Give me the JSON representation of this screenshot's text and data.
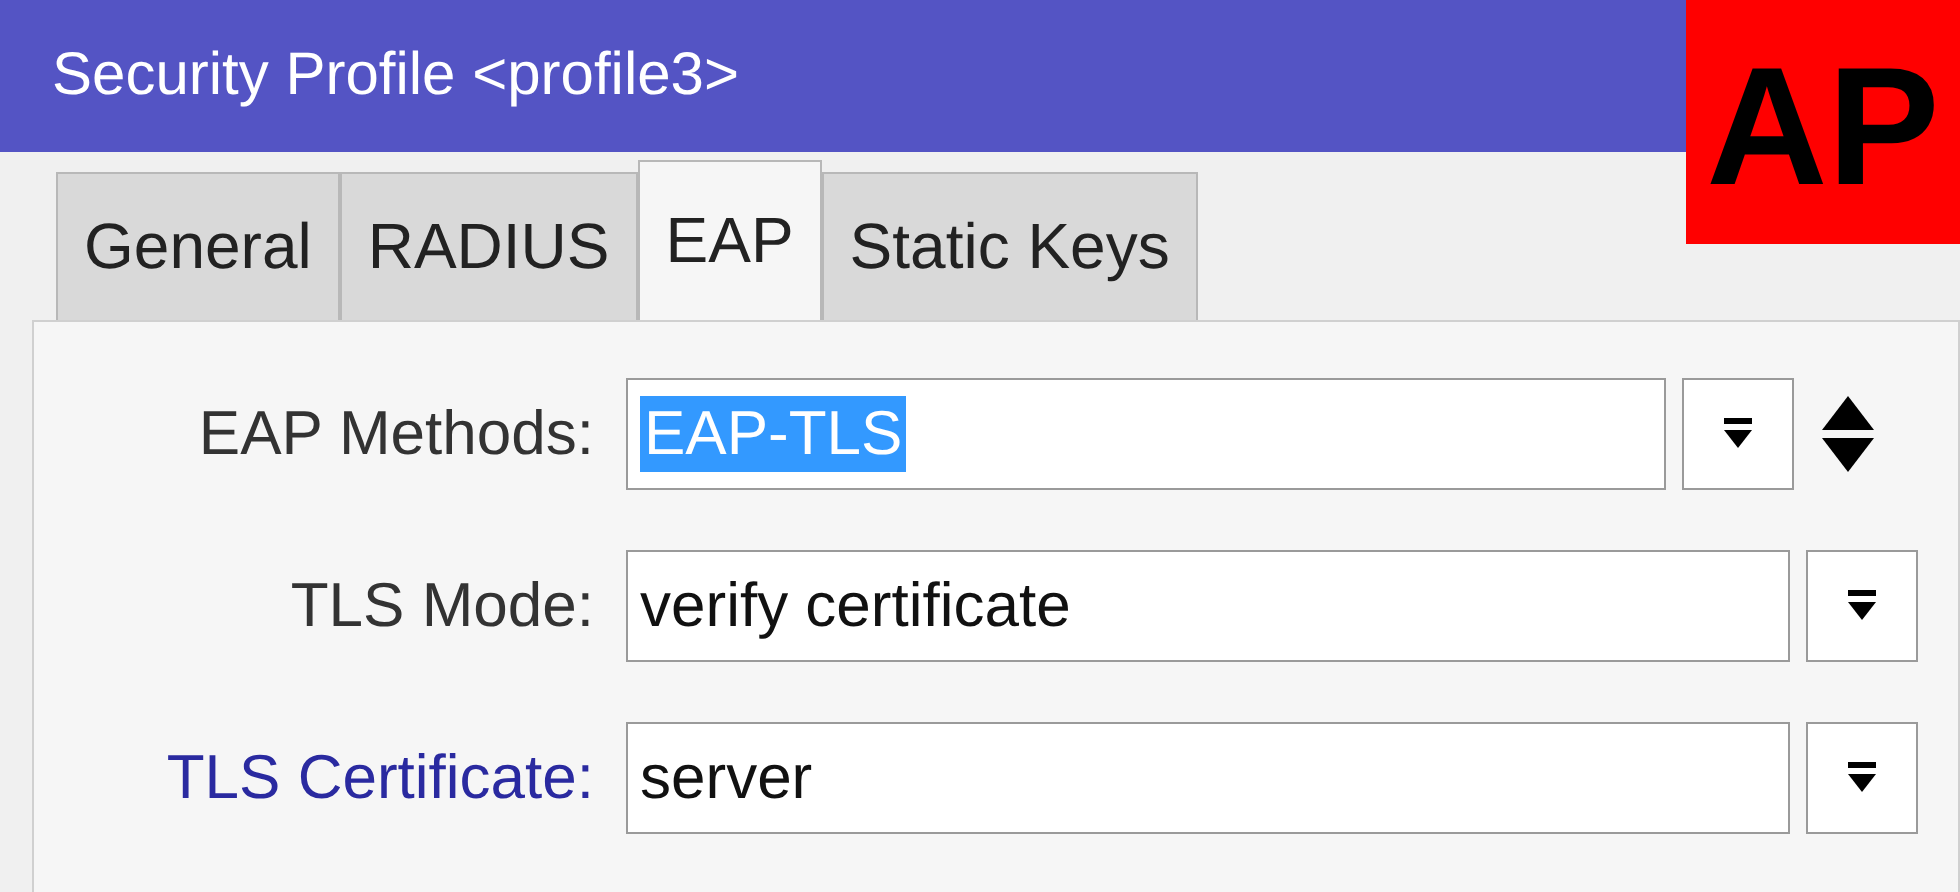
{
  "window": {
    "title": "Security Profile <profile3>"
  },
  "annotation": {
    "text": "AP"
  },
  "tabs": [
    {
      "label": "General",
      "selected": false
    },
    {
      "label": "RADIUS",
      "selected": false
    },
    {
      "label": "EAP",
      "selected": true
    },
    {
      "label": "Static Keys",
      "selected": false
    }
  ],
  "fields": [
    {
      "kind": "list",
      "label": "EAP Methods:",
      "label_link": false,
      "value": "EAP-TLS",
      "selected": true
    },
    {
      "kind": "single",
      "label": "TLS Mode:",
      "label_link": false,
      "value": "verify certificate",
      "selected": false
    },
    {
      "kind": "single",
      "label": "TLS Certificate:",
      "label_link": true,
      "value": "server",
      "selected": false
    }
  ]
}
